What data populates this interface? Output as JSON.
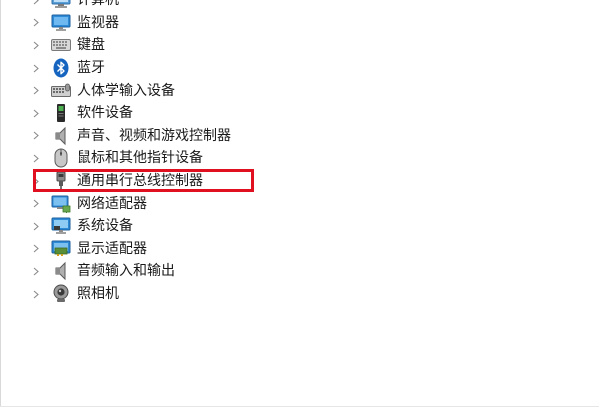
{
  "tree": {
    "items": [
      {
        "label": "计算机",
        "icon": "computer-icon"
      },
      {
        "label": "监视器",
        "icon": "monitor-icon"
      },
      {
        "label": "键盘",
        "icon": "keyboard-icon"
      },
      {
        "label": "蓝牙",
        "icon": "bluetooth-icon"
      },
      {
        "label": "人体学输入设备",
        "icon": "hid-icon"
      },
      {
        "label": "软件设备",
        "icon": "software-device-icon"
      },
      {
        "label": "声音、视频和游戏控制器",
        "icon": "speaker-icon"
      },
      {
        "label": "鼠标和其他指针设备",
        "icon": "mouse-icon"
      },
      {
        "label": "通用串行总线控制器",
        "icon": "usb-icon"
      },
      {
        "label": "网络适配器",
        "icon": "network-adapter-icon"
      },
      {
        "label": "系统设备",
        "icon": "system-device-icon"
      },
      {
        "label": "显示适配器",
        "icon": "display-adapter-icon"
      },
      {
        "label": "音频输入和输出",
        "icon": "audio-io-icon"
      },
      {
        "label": "照相机",
        "icon": "camera-icon"
      }
    ]
  },
  "highlight": {
    "target_label": "通用串行总线控制器",
    "color": "#e01020"
  },
  "colors": {
    "bluetooth": "#1565c0",
    "monitor_screen": "#2e8bd8",
    "chevron": "#8a8a8a"
  }
}
